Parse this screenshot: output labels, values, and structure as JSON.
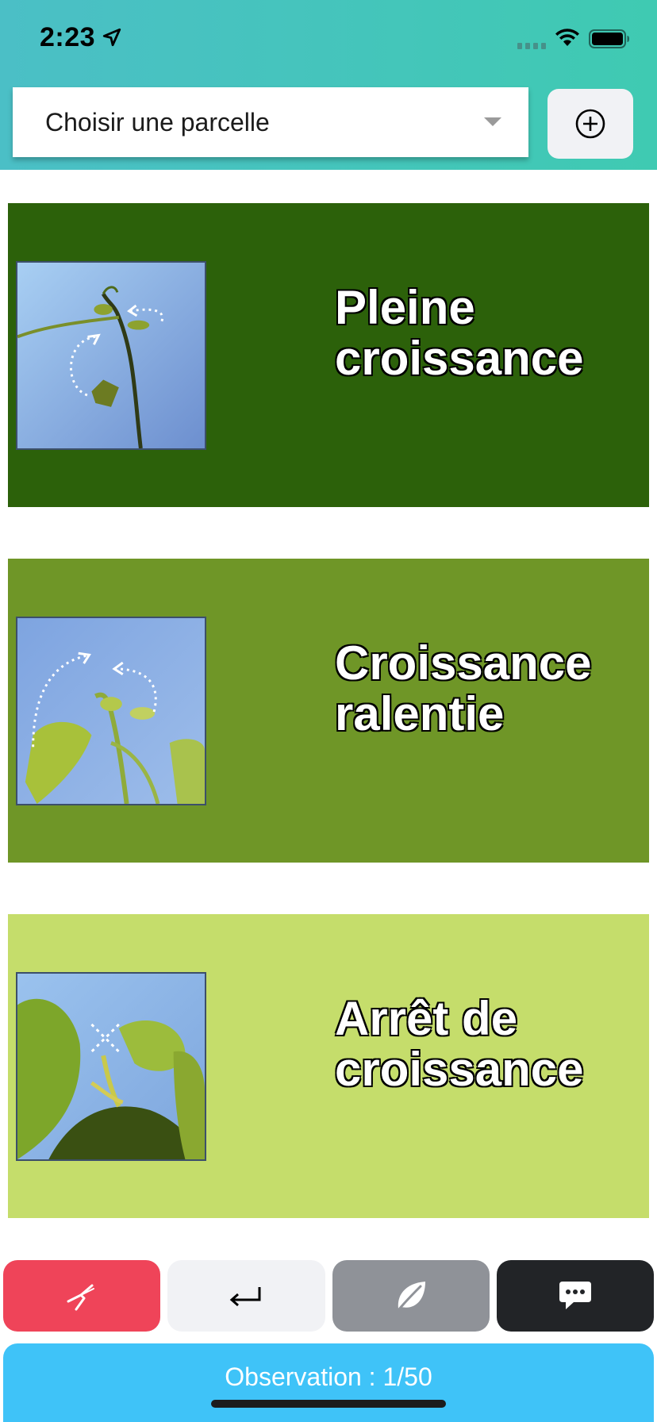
{
  "status_bar": {
    "time": "2:23"
  },
  "header": {
    "select_placeholder": "Choisir une parcelle"
  },
  "cards": [
    {
      "title_line1": "Pleine",
      "title_line2": "croissance",
      "color": "#2c610a"
    },
    {
      "title_line1": "Croissance",
      "title_line2": "ralentie",
      "color": "#6f9627"
    },
    {
      "title_line1": "Arrêt de",
      "title_line2": "croissance",
      "color": "#c5dd6b"
    }
  ],
  "actions": [
    {
      "icon": "pruning-shears-icon",
      "color": "#ef4459"
    },
    {
      "icon": "return-arrow-icon",
      "color": "#f1f2f5"
    },
    {
      "icon": "leaf-icon",
      "color": "#8f9298"
    },
    {
      "icon": "chat-bubble-icon",
      "color": "#222427"
    }
  ],
  "footer": {
    "observation_text": "Observation : 1/50",
    "color": "#3fc3f8"
  },
  "colors": {
    "header_start": "#4bbfc6",
    "header_end": "#3fcab2"
  }
}
